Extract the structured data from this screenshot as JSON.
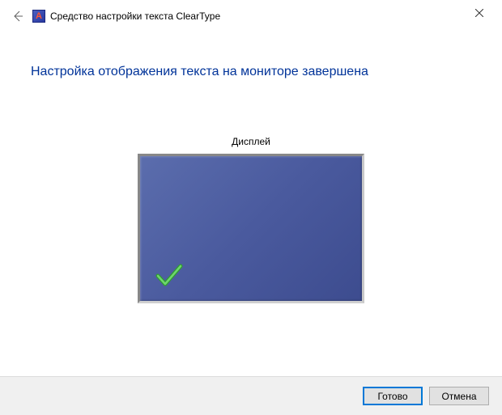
{
  "window": {
    "title": "Средство настройки текста ClearType"
  },
  "heading": "Настройка отображения текста на мониторе завершена",
  "display_label": "Дисплей",
  "buttons": {
    "finish": "Готово",
    "cancel": "Отмена"
  }
}
